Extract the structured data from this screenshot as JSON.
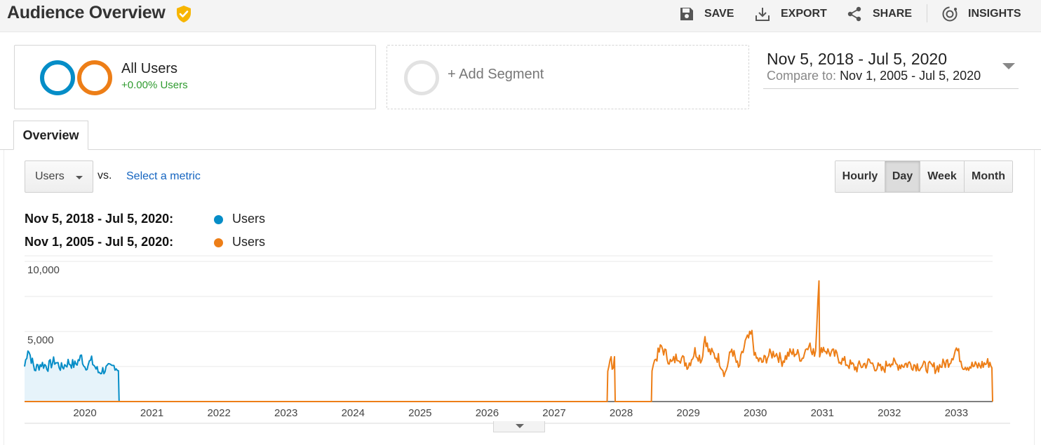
{
  "header": {
    "title": "Audience Overview",
    "actions": {
      "save": "SAVE",
      "export": "EXPORT",
      "share": "SHARE",
      "insights": "INSIGHTS"
    }
  },
  "segments": {
    "active": {
      "name": "All Users",
      "stat": "+0.00% Users"
    },
    "add_label": "+ Add Segment"
  },
  "date_range": {
    "main": "Nov 5, 2018 - Jul 5, 2020",
    "compare_label": "Compare to:",
    "compare_value": "Nov 1, 2005 - Jul 5, 2020"
  },
  "tabs": [
    {
      "label": "Overview",
      "active": true
    }
  ],
  "controls": {
    "metric_selected": "Users",
    "vs": "vs.",
    "select_metric": "Select a metric",
    "granularity": [
      {
        "label": "Hourly",
        "active": false
      },
      {
        "label": "Day",
        "active": true
      },
      {
        "label": "Week",
        "active": false
      },
      {
        "label": "Month",
        "active": false
      }
    ]
  },
  "legend": [
    {
      "range": "Nov 5, 2018 - Jul 5, 2020:",
      "series": "Users",
      "color": "#058dc7"
    },
    {
      "range": "Nov 1, 2005 - Jul 5, 2020:",
      "series": "Users",
      "color": "#ed7e17"
    }
  ],
  "colors": {
    "current": "#058dc7",
    "compare": "#ed7e17",
    "current_fill": "#e6f3fa",
    "positive": "#2f9b2f",
    "verified": "#f7b500"
  },
  "chart_data": {
    "type": "line",
    "x_ticks": [
      "2020",
      "2021",
      "2022",
      "2023",
      "2024",
      "2025",
      "2026",
      "2027",
      "2028",
      "2029",
      "2030",
      "2031",
      "2032",
      "2033"
    ],
    "y_ticks": [
      "10,000",
      "5,000"
    ],
    "ylim": [
      0,
      10000
    ],
    "xlim": [
      2019.1,
      2033.54
    ],
    "grid": true,
    "series": [
      {
        "name": "Users",
        "color": "#058dc7",
        "filled": true,
        "x": [
          2019.1,
          2019.15,
          2019.25,
          2019.35,
          2019.45,
          2019.55,
          2019.65,
          2019.75,
          2019.85,
          2019.95,
          2020.0,
          2020.1,
          2020.2,
          2020.3,
          2020.4,
          2020.45,
          2020.5,
          2020.51
        ],
        "y": [
          2500,
          3800,
          2300,
          2700,
          2500,
          2900,
          2400,
          2800,
          2600,
          3200,
          2500,
          2900,
          2100,
          2300,
          2400,
          2600,
          2200,
          0
        ]
      },
      {
        "name": "Users",
        "color": "#ed7e17",
        "filled": false,
        "x": [
          2019.1,
          2027.79,
          2027.8,
          2027.85,
          2027.88,
          2027.9,
          2027.91,
          2028.45,
          2028.46,
          2028.5,
          2028.6,
          2028.75,
          2028.85,
          2029.0,
          2029.1,
          2029.2,
          2029.25,
          2029.3,
          2029.45,
          2029.55,
          2029.65,
          2029.75,
          2029.85,
          2029.95,
          2030.0,
          2030.1,
          2030.2,
          2030.3,
          2030.4,
          2030.5,
          2030.6,
          2030.7,
          2030.8,
          2030.85,
          2030.9,
          2030.95,
          2030.96,
          2030.97,
          2031.0,
          2031.1,
          2031.2,
          2031.3,
          2031.5,
          2031.7,
          2031.9,
          2032.0,
          2032.1,
          2032.3,
          2032.5,
          2032.7,
          2032.9,
          2033.0,
          2033.1,
          2033.3,
          2033.5,
          2033.53,
          2033.54
        ],
        "y": [
          0,
          0,
          2400,
          3000,
          2000,
          3200,
          0,
          0,
          2600,
          2900,
          3900,
          2700,
          3300,
          2600,
          3600,
          3000,
          4700,
          3600,
          3100,
          2000,
          3800,
          2300,
          4200,
          4800,
          3100,
          2800,
          3300,
          3500,
          2900,
          3400,
          3500,
          3100,
          4300,
          3300,
          3700,
          9000,
          3500,
          3200,
          3900,
          3500,
          3300,
          2900,
          2400,
          2800,
          2200,
          2900,
          2600,
          2700,
          2500,
          2400,
          2900,
          3800,
          2600,
          2500,
          2800,
          2400,
          0
        ]
      }
    ]
  }
}
